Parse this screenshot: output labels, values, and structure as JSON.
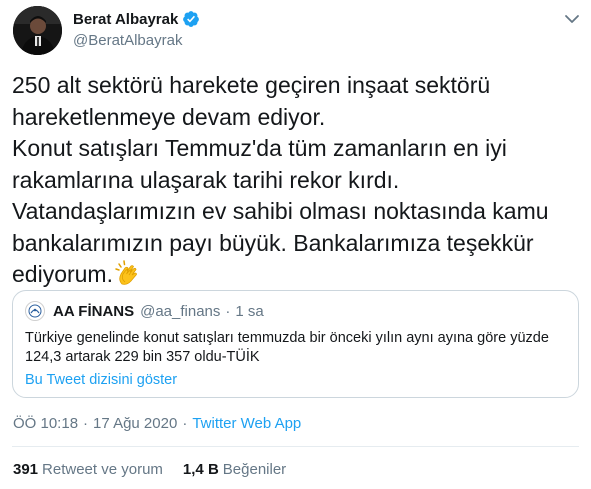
{
  "author": {
    "display_name": "Berat Albayrak",
    "handle": "@BeratAlbayrak",
    "verified": true
  },
  "tweet": {
    "lines": [
      "250 alt sektörü harekete geçiren inşaat sektörü",
      "hareketlenmeye devam ediyor.",
      "Konut satışları Temmuz'da tüm zamanların en iyi",
      "rakamlarına ulaşarak tarihi rekor kırdı.",
      "Vatandaşlarımızın ev sahibi olması noktasında kamu",
      "bankalarımızın payı büyük. Bankalarımıza teşekkür",
      "ediyorum."
    ],
    "emoji": "clapping-hands-icon"
  },
  "quoted": {
    "name": "AA FİNANS",
    "handle": "@aa_finans",
    "separator": "·",
    "time": "1 sa",
    "lines": [
      "Türkiye genelinde konut satışları temmuzda bir önceki yılın aynı ayına göre yüzde",
      "124,3 artarak 229 bin 357 oldu-TÜİK"
    ],
    "show_thread": "Bu Tweet dizisini göster"
  },
  "meta": {
    "time": "ÖÖ 10:18",
    "sep1": "·",
    "date": "17 Ağu 2020",
    "sep2": "·",
    "source": "Twitter Web App"
  },
  "stats": {
    "retweets_count": "391",
    "retweets_label": "Retweet ve yorum",
    "likes_count": "1,4 B",
    "likes_label": "Beğeniler"
  },
  "colors": {
    "link": "#1da1f2",
    "secondary_text": "#657786",
    "primary_text": "#14171a",
    "border": "#ccd6dd"
  }
}
